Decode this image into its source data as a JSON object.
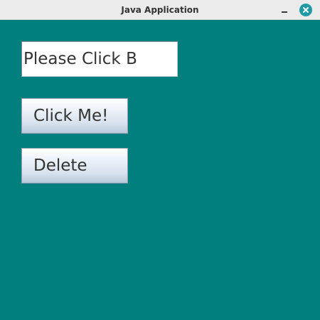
{
  "window": {
    "title": "Java Application",
    "controls": {
      "minimize_icon": "minimize-icon",
      "close_icon": "close-icon"
    },
    "background_color": "#007f7f",
    "close_button_color": "#1f9aa5"
  },
  "form": {
    "text_field_value": "Please Click B",
    "click_button_label": "Click Me!",
    "delete_button_label": "Delete"
  }
}
